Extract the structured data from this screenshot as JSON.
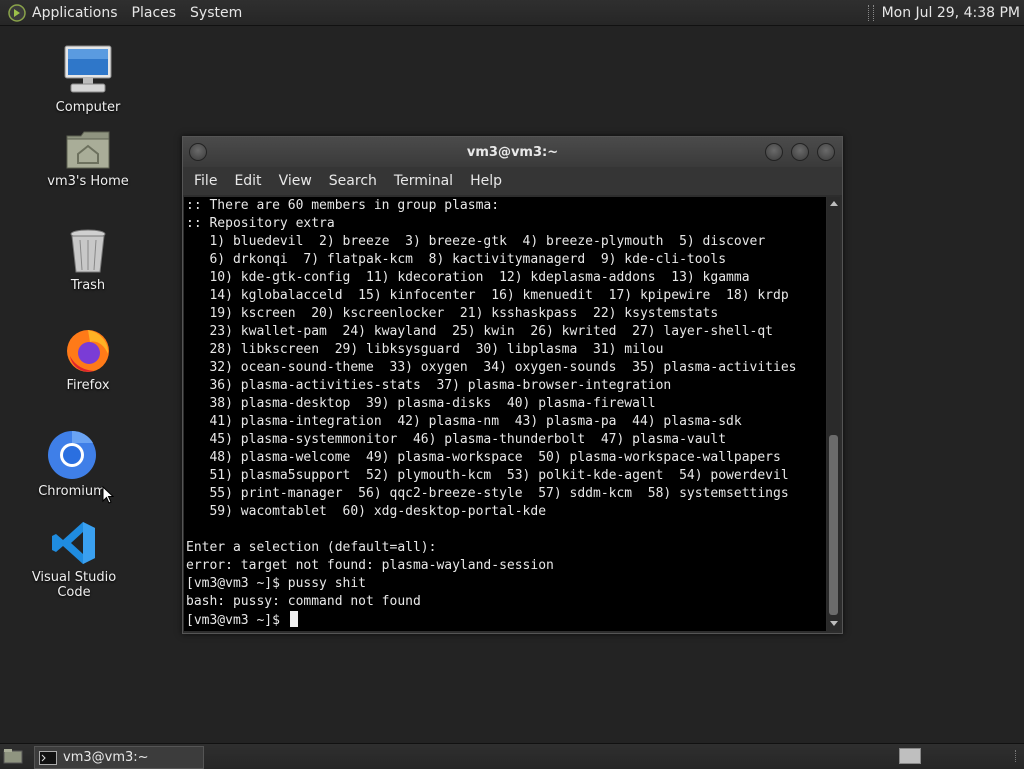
{
  "top_panel": {
    "menus": [
      "Applications",
      "Places",
      "System"
    ],
    "clock": "Mon Jul 29,  4:38 PM"
  },
  "desktop": {
    "icons": [
      {
        "label": "Computer",
        "icon": "computer-icon"
      },
      {
        "label": "vm3's Home",
        "icon": "home-folder-icon"
      },
      {
        "label": "Trash",
        "icon": "trash-icon"
      },
      {
        "label": "Firefox",
        "icon": "firefox-icon"
      },
      {
        "label": "Chromium",
        "icon": "chromium-icon"
      },
      {
        "label": "Visual Studio Code",
        "icon": "vscode-icon"
      }
    ]
  },
  "terminal": {
    "title": "vm3@vm3:~",
    "menus": [
      "File",
      "Edit",
      "View",
      "Search",
      "Terminal",
      "Help"
    ],
    "lines": [
      ":: There are 60 members in group plasma:",
      ":: Repository extra",
      "   1) bluedevil  2) breeze  3) breeze-gtk  4) breeze-plymouth  5) discover",
      "   6) drkonqi  7) flatpak-kcm  8) kactivitymanagerd  9) kde-cli-tools",
      "   10) kde-gtk-config  11) kdecoration  12) kdeplasma-addons  13) kgamma",
      "   14) kglobalacceld  15) kinfocenter  16) kmenuedit  17) kpipewire  18) krdp",
      "   19) kscreen  20) kscreenlocker  21) ksshaskpass  22) ksystemstats",
      "   23) kwallet-pam  24) kwayland  25) kwin  26) kwrited  27) layer-shell-qt",
      "   28) libkscreen  29) libksysguard  30) libplasma  31) milou",
      "   32) ocean-sound-theme  33) oxygen  34) oxygen-sounds  35) plasma-activities",
      "   36) plasma-activities-stats  37) plasma-browser-integration",
      "   38) plasma-desktop  39) plasma-disks  40) plasma-firewall",
      "   41) plasma-integration  42) plasma-nm  43) plasma-pa  44) plasma-sdk",
      "   45) plasma-systemmonitor  46) plasma-thunderbolt  47) plasma-vault",
      "   48) plasma-welcome  49) plasma-workspace  50) plasma-workspace-wallpapers",
      "   51) plasma5support  52) plymouth-kcm  53) polkit-kde-agent  54) powerdevil",
      "   55) print-manager  56) qqc2-breeze-style  57) sddm-kcm  58) systemsettings",
      "   59) wacomtablet  60) xdg-desktop-portal-kde",
      "",
      "Enter a selection (default=all):",
      "error: target not found: plasma-wayland-session",
      "[vm3@vm3 ~]$ pussy shit",
      "bash: pussy: command not found",
      "[vm3@vm3 ~]$ "
    ]
  },
  "bottom_panel": {
    "task_label": "vm3@vm3:~"
  }
}
